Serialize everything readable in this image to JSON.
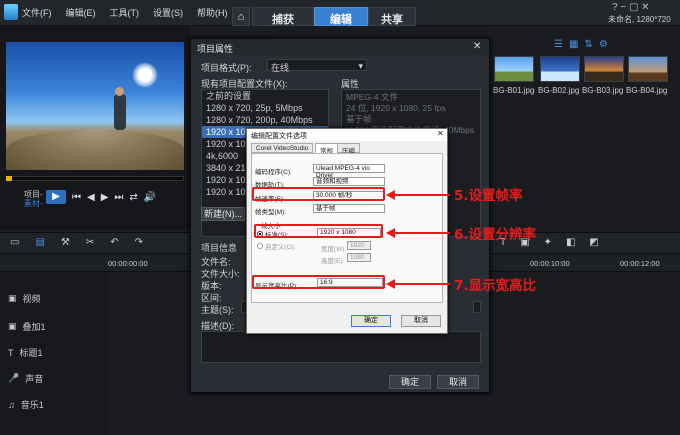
{
  "menu": [
    "文件(F)",
    "编辑(E)",
    "工具(T)",
    "设置(S)",
    "帮助(H)"
  ],
  "tabs": [
    "捕获",
    "编辑",
    "共享"
  ],
  "project_info": "未命名, 1280*720",
  "thumbnails": [
    "BG-B01.jpg",
    "BG-B02.jpg",
    "BG-B03.jpg",
    "BG-B04.jpg"
  ],
  "player": {
    "project_label": "项目-",
    "clip_label": "素材-"
  },
  "tracks": [
    "视频",
    "叠加1",
    "标题1",
    "声音",
    "音乐1"
  ],
  "timecodes": [
    "00:00:00:00",
    "00:00:10:00",
    "00:00:12:00"
  ],
  "props_dialog": {
    "title": "项目属性",
    "format_label": "项目格式(P):",
    "format_value": "在线",
    "existing_label": "现有项目配置文件(X):",
    "props_label": "属性",
    "list": [
      "之前的设置",
      "1280 x 720, 25p, 5Mbps",
      "1280 x 720, 200p, 40Mbps",
      "1920 x 108",
      "1920 x 108",
      "4k,6000",
      "3840 x 216",
      "1920 x 108",
      "1920 x 108"
    ],
    "properties": [
      "MPEG-4 文件",
      "24 位, 1920 x 1080, 25 fps",
      "基于帧",
      "H.264 高级配置文件视频: 40Mbps"
    ],
    "new_btn": "新建(N)...",
    "info_label": "项目信息",
    "info_fields": [
      "文件名:",
      "文件大小:",
      "版本:",
      "区间:",
      "主题(S):",
      "描述(D):"
    ],
    "ok": "确定",
    "cancel": "取消"
  },
  "profile_dialog": {
    "title": "编辑配置文件选项",
    "tabs": [
      "Corel VideoStudio",
      "常规",
      "压缩"
    ],
    "codec_label": "编码程序(C):",
    "codec_value": "Ulead MPEG-4 vio Driver",
    "track_label": "数据轨(T):",
    "track_value": "音频和视频",
    "framerate_label": "帧速率(F):",
    "framerate_value": "30.000 帧/秒",
    "frametype_label": "帧类型(M):",
    "frametype_value": "基于帧",
    "framesize_label": "帧大小",
    "standard_label": "标准(S):",
    "standard_value": "1920 x 1080",
    "custom_label": "自定义(O):",
    "width_label": "宽度(W):",
    "width_value": "1920",
    "height_label": "高度(E):",
    "height_value": "1080",
    "aspect_label": "显示宽高比(P):",
    "aspect_value": "16:9",
    "ok": "确定",
    "cancel": "取消"
  },
  "annotations": [
    "5.设置帧率",
    "6.设置分辨率",
    "7.显示宽高比"
  ],
  "colors": {
    "accent": "#3b7fd0",
    "annotation": "#e51c1c"
  }
}
